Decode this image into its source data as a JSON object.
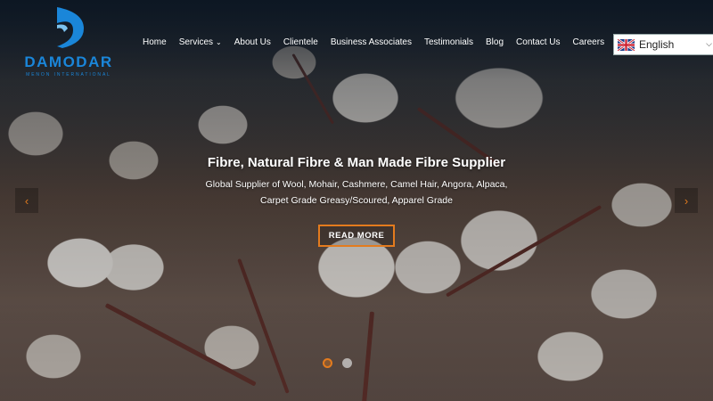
{
  "brand": {
    "name": "DAMODAR",
    "tagline": "MENON INTERNATIONAL",
    "accent_color": "#1a86d9"
  },
  "nav": {
    "items": [
      {
        "label": "Home"
      },
      {
        "label": "Services",
        "has_dropdown": true,
        "dropdown_icon": "chevron-down-icon"
      },
      {
        "label": "About Us"
      },
      {
        "label": "Clientele"
      },
      {
        "label": "Business Associates"
      },
      {
        "label": "Testimonials"
      },
      {
        "label": "Blog"
      },
      {
        "label": "Contact Us"
      },
      {
        "label": "Careers"
      }
    ]
  },
  "language_selector": {
    "flag_icon": "uk-flag-icon",
    "selected": "English"
  },
  "hero": {
    "title": "Fibre, Natural Fibre & Man Made Fibre Supplier",
    "subtitle_line1": "Global Supplier of Wool, Mohair, Cashmere, Camel Hair, Angora, Alpaca,",
    "subtitle_line2": "Carpet Grade Greasy/Scoured, Apparel Grade",
    "cta_label": "READ MORE",
    "cta_color": "#e37b1e",
    "prev_icon": "chevron-left-icon",
    "next_icon": "chevron-right-icon"
  },
  "slider": {
    "total_slides": 2,
    "active_index": 0
  }
}
